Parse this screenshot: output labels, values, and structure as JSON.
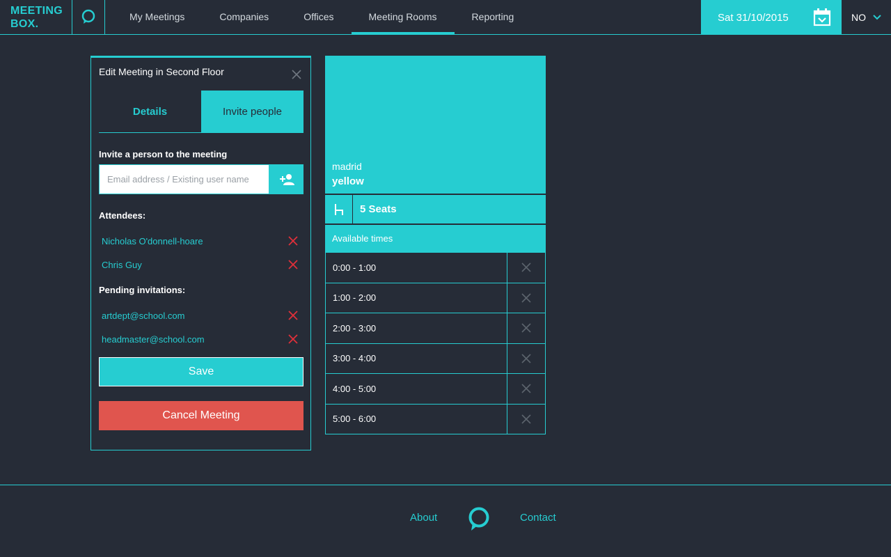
{
  "header": {
    "logo_line1": "MEETING",
    "logo_line2": "BOX.",
    "logo_icon": "chat-bubble-icon",
    "nav": [
      {
        "label": "My Meetings",
        "active": false
      },
      {
        "label": "Companies",
        "active": false
      },
      {
        "label": "Offices",
        "active": false
      },
      {
        "label": "Meeting Rooms",
        "active": true
      },
      {
        "label": "Reporting",
        "active": false
      }
    ],
    "date": "Sat 31/10/2015",
    "calendar_icon": "calendar-check-icon",
    "language": "NO",
    "language_icon": "chevron-down-icon"
  },
  "edit_panel": {
    "title": "Edit Meeting in Second Floor",
    "tabs": {
      "details": "Details",
      "invite": "Invite people"
    },
    "invite_label": "Invite a person to the meeting",
    "invite_placeholder": "Email address / Existing user name",
    "invite_button_icon": "add-person-icon",
    "attendees_label": "Attendees:",
    "attendees": [
      "Nicholas O'donnell-hoare",
      "Chris Guy"
    ],
    "pending_label": "Pending invitations:",
    "pending": [
      "artdept@school.com",
      "headmaster@school.com"
    ],
    "save_label": "Save",
    "cancel_label": "Cancel Meeting"
  },
  "room": {
    "city": "madrid",
    "name": "yellow",
    "seat_icon": "chair-icon",
    "seats": "5 Seats",
    "available_label": "Available times",
    "slots": [
      "0:00 - 1:00",
      "1:00 - 2:00",
      "2:00 - 3:00",
      "3:00 - 4:00",
      "4:00 - 5:00",
      "5:00 - 6:00"
    ]
  },
  "footer": {
    "about": "About",
    "contact": "Contact",
    "logo_icon": "chat-bubble-icon"
  },
  "colors": {
    "accent": "#26cdd1",
    "background": "#262c37",
    "danger": "#e0554e",
    "remove": "#e0303a"
  }
}
